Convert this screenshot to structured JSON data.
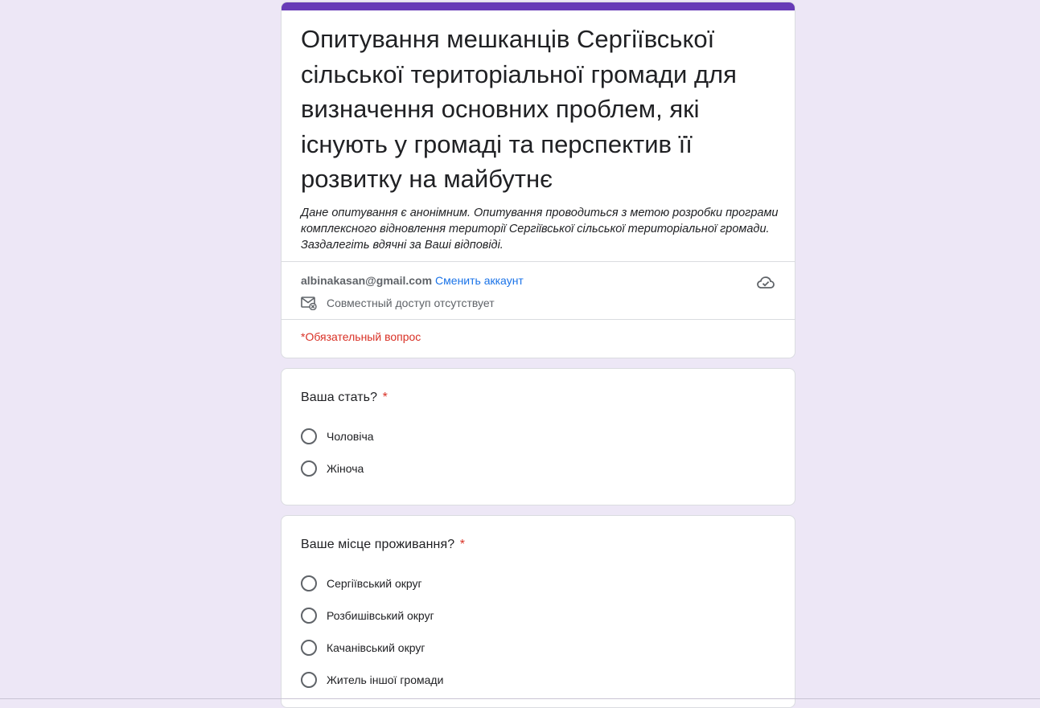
{
  "colors": {
    "accent": "#673ab7",
    "background": "#ede7f6",
    "link": "#1a73e8",
    "required": "#d93025"
  },
  "header": {
    "title": "Опитування мешканців Сергіївської сільської територіальної громади для визначення основних проблем, які існують у громаді та перспектив її розвитку на майбутнє",
    "description": "Дане опитування є анонімним. Опитування проводиться з метою розробки програми комплексного відновлення території Сергіївської сільської територіальної громади. Заздалегіть вдячні за Ваші відповіді.",
    "account_email": "albinakasan@gmail.com",
    "switch_account": "Сменить аккаунт",
    "sharing_status": "Совместный доступ отсутствует",
    "required_note": "*Обязательный вопрос",
    "icons": {
      "sharing": "mail-off-icon",
      "save": "cloud-check-icon"
    }
  },
  "questions": [
    {
      "title": "Ваша стать?",
      "required_mark": "*",
      "options": [
        "Чоловіча",
        "Жіноча"
      ]
    },
    {
      "title": "Ваше місце проживання?",
      "required_mark": "*",
      "options": [
        "Сергіївський округ",
        "Розбишівський округ",
        "Качанівський округ",
        "Житель іншої громади"
      ]
    }
  ]
}
